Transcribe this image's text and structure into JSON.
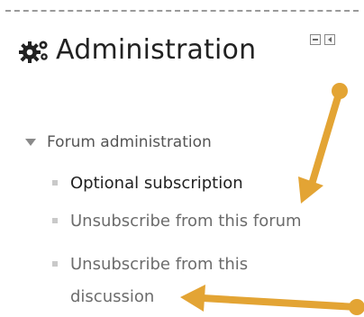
{
  "block": {
    "title": "Administration",
    "controls": {
      "hide_icon": "collapse-icon",
      "dock_icon": "dock-icon"
    }
  },
  "tree": {
    "root_label": "Forum administration",
    "items": [
      {
        "label": "Optional subscription",
        "style": "strong"
      },
      {
        "label": "Unsubscribe from this forum",
        "style": "link"
      },
      {
        "label": "Unsubscribe from this discussion",
        "style": "link"
      }
    ]
  },
  "colors": {
    "annotation_arrow": "#e3a434",
    "link_text": "#6c6c6c",
    "dashed_border": "#9a9a9a"
  }
}
